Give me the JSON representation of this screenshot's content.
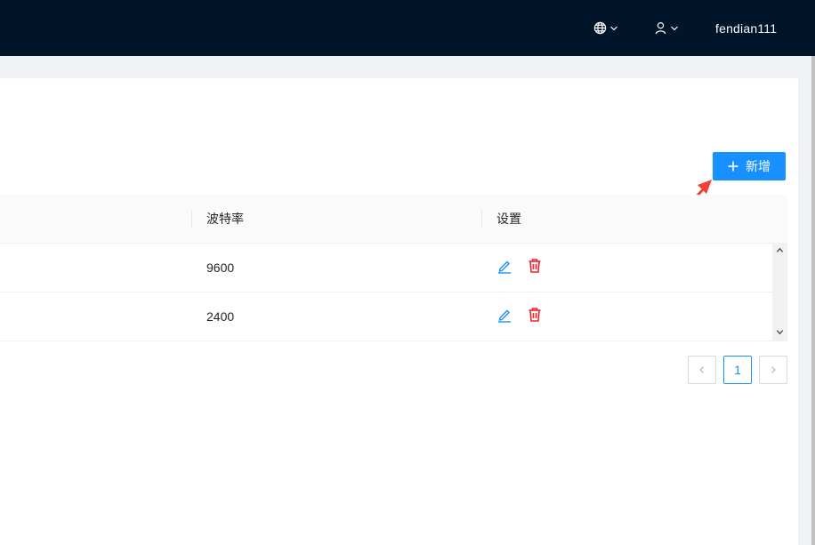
{
  "header": {
    "language_icon": "globe-icon",
    "user_icon": "user-icon",
    "username": "fendian111"
  },
  "toolbar": {
    "add_label": "新增"
  },
  "table": {
    "columns": [
      "波特率",
      "设置"
    ],
    "rows": [
      {
        "baud": "9600"
      },
      {
        "baud": "2400"
      }
    ]
  },
  "pagination": {
    "current": "1"
  },
  "colors": {
    "header_bg": "#001529",
    "primary": "#1890ff",
    "danger": "#f5222d",
    "annotation_arrow": "#f04134"
  }
}
